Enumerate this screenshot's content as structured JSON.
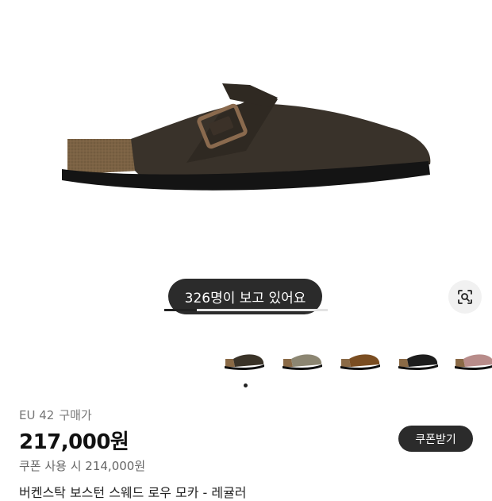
{
  "product": {
    "image_alt": "Birkenstock Boston clog",
    "viewers_badge": "326명이 보고 있어요",
    "carousel_progress": 0.2,
    "thumbnails": [
      {
        "name": "thumb-mocha",
        "color": "#3a3328"
      },
      {
        "name": "thumb-taupe",
        "color": "#8c8672"
      },
      {
        "name": "thumb-mink",
        "color": "#7a4d21"
      },
      {
        "name": "thumb-black",
        "color": "#1d1d1d"
      },
      {
        "name": "thumb-pink",
        "color": "#b88c8a"
      }
    ],
    "size": "EU 42",
    "size_suffix": "구매가",
    "price": "217,000원",
    "coupon_note": "쿠폰 사용 시 214,000원",
    "coupon_button": "쿠폰받기",
    "name_partial": "버켄스탁 보스턴 스웨드 로우 모카 - 레귤러"
  },
  "colors": {
    "accent": "#2b2b2b",
    "sole": "#1a1a1a",
    "cork": "#7a6040",
    "upper": "#3a3328"
  }
}
